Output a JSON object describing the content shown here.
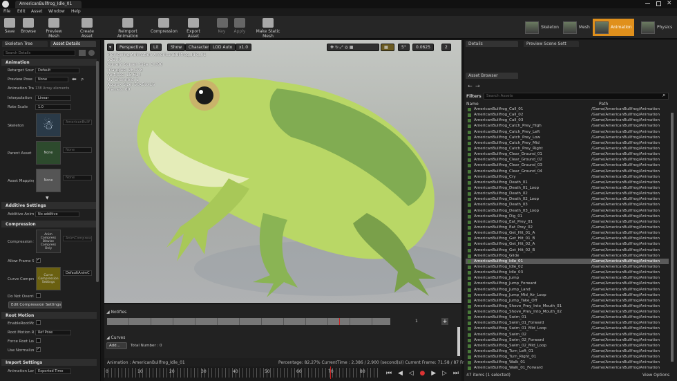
{
  "window": {
    "tab_title": "AmericanBullfrog_Idle_01"
  },
  "menu": [
    "File",
    "Edit",
    "Asset",
    "Window",
    "Help"
  ],
  "toolbar": [
    {
      "label": "Save"
    },
    {
      "label": "Browse"
    },
    {
      "label": "Preview Mesh"
    },
    {
      "label": "Create Asset"
    },
    {
      "label": "Reimport Animation"
    },
    {
      "label": "Compression"
    },
    {
      "label": "Export Asset"
    },
    {
      "label": "Key"
    },
    {
      "label": "Apply"
    },
    {
      "label": "Make Static Mesh"
    }
  ],
  "modes": [
    {
      "label": "Skeleton"
    },
    {
      "label": "Mesh"
    },
    {
      "label": "Animation"
    },
    {
      "label": "Physics"
    }
  ],
  "left": {
    "tabs": [
      "Skeleton Tree",
      "Asset Details"
    ],
    "search_placeholder": "Search Details",
    "sections": {
      "animation": "Animation",
      "additive": "Additive Settings",
      "compression": "Compression",
      "root_motion": "Root Motion",
      "import": "Import Settings"
    },
    "labels": {
      "retarget": "Retarget Sourc",
      "preview_pose": "Preview Pose ",
      "anim_track": "Animation Trac",
      "interpolation": "Interpolation",
      "rate_scale": "Rate Scale",
      "skeleton": "Skeleton",
      "parent_asset": "Parent Asset",
      "asset_mapping": "Asset Mapping",
      "additive_anim": "Additive Anim",
      "compression_s": "Compression S",
      "allow_frame": "Allow Frame St",
      "curve_compr": "Curve Compres",
      "do_not_override": "Do Not Overrid",
      "enable_root": "EnableRootMot",
      "root_motion_r": "Root Motion Ro",
      "force_root": "Force Root Loc",
      "use_normalize": "Use Normalize",
      "anim_length": "Animation Len"
    },
    "values": {
      "retarget": "Default",
      "preview_pose": "None",
      "anim_track": "138 Array elements",
      "interpolation": "Linear",
      "rate_scale": "1.0",
      "skeleton_name": "AmericanBullf",
      "parent_thumb": "None",
      "parent_none": "None",
      "mapping_thumb": "None",
      "mapping_none": "None",
      "additive_anim": "No additive",
      "compression_thumb": "Anim Compress Bitwise Compress Only",
      "compression_name": "AnimCompress",
      "curve_thumb": "Curve Compression Settings",
      "curve_name": "DefaultAnimC",
      "edit_compression": "Edit Compression Settings",
      "root_motion_r": "Ref Pose",
      "anim_length": "Exported Time"
    }
  },
  "viewport": {
    "buttons": [
      "Perspective",
      "Lit",
      "Show",
      "Character",
      "LOD Auto",
      "x1.0"
    ],
    "snap_value": "5°",
    "scale_value": "0.0625",
    "cam_speed": "2",
    "info": [
      "Previewing Animation AmericanBullfrog_Idle_01",
      "LOD: 0",
      "Current Screen Size: 3.096",
      "Triangles: 28,978",
      "Vertices: 15,614",
      "UV Channels: 1",
      "Approx Size: 50x59x16",
      "Frames: 80"
    ]
  },
  "timeline": {
    "notifies": "Notifies",
    "curves": "Curves",
    "add": "Add...",
    "total": "Total Number : 0",
    "track_number": "1"
  },
  "anim_bar": {
    "name": "Animation : AmericanBullfrog_Idle_01",
    "status": "Percentage: 82.27% CurrentTime : 2.386 / 2.900 (second(s)) Current Frame: 71.58 / 87 Frame"
  },
  "ruler": [
    "0",
    "10",
    "20",
    "30",
    "40",
    "50",
    "60",
    "70",
    "80"
  ],
  "right": {
    "tabs": [
      "Details",
      "Preview Scene Sett"
    ],
    "asset_browser_tab": "Asset Browser",
    "filters": "Filters",
    "search_placeholder": "Search Assets",
    "col_name": "Name",
    "col_path": "Path",
    "path": "/Game/AmericanBullfrog/Animation",
    "assets": [
      "AmericanBullfrog_Call_01",
      "AmericanBullfrog_Call_02",
      "AmericanBullfrog_Call_03",
      "AmericanBullfrog_Catch_Prey_High",
      "AmericanBullfrog_Catch_Prey_Left",
      "AmericanBullfrog_Catch_Prey_Low",
      "AmericanBullfrog_Catch_Prey_Mid",
      "AmericanBullfrog_Catch_Prey_Right",
      "AmericanBullfrog_Clear_Ground_01",
      "AmericanBullfrog_Clear_Ground_02",
      "AmericanBullfrog_Clear_Ground_03",
      "AmericanBullfrog_Clear_Ground_04",
      "AmericanBullfrog_Cry",
      "AmericanBullfrog_Death_01",
      "AmericanBullfrog_Death_01_Loop",
      "AmericanBullfrog_Death_02",
      "AmericanBullfrog_Death_02_Loop",
      "AmericanBullfrog_Death_03",
      "AmericanBullfrog_Death_03_Loop",
      "AmericanBullfrog_Dig_01",
      "AmericanBullfrog_Eat_Prey_01",
      "AmericanBullfrog_Eat_Prey_02",
      "AmericanBullfrog_Get_Hit_01_A",
      "AmericanBullfrog_Get_Hit_01_B",
      "AmericanBullfrog_Get_Hit_02_A",
      "AmericanBullfrog_Get_Hit_02_B",
      "AmericanBullfrog_Glide",
      "AmericanBullfrog_Idle_01",
      "AmericanBullfrog_Idle_02",
      "AmericanBullfrog_Idle_03",
      "AmericanBullfrog_Jump",
      "AmericanBullfrog_Jump_Forward",
      "AmericanBullfrog_Jump_Land",
      "AmericanBullfrog_Jump_Mid_Air_Loop",
      "AmericanBullfrog_Jump_Take_Off",
      "AmericanBullfrog_Shove_Prey_Into_Mouth_01",
      "AmericanBullfrog_Shove_Prey_Into_Mouth_02",
      "AmericanBullfrog_Swim_01",
      "AmericanBullfrog_Swim_01_Forward",
      "AmericanBullfrog_Swim_01_Mid_Loop",
      "AmericanBullfrog_Swim_02",
      "AmericanBullfrog_Swim_02_Forward",
      "AmericanBullfrog_Swim_02_Mid_Loop",
      "AmericanBullfrog_Turn_Left_01",
      "AmericanBullfrog_Turn_Right_01",
      "AmericanBullfrog_Walk_01",
      "AmericanBullfrog_Walk_01_Forward"
    ],
    "selected_index": 27,
    "status": "47 items (1 selected)",
    "view_options": "View Options"
  },
  "colors": {
    "accent": "#e0901c",
    "panel": "#1f1f1f",
    "frog_light": "#b9d766",
    "frog_dark": "#3d6b35"
  }
}
